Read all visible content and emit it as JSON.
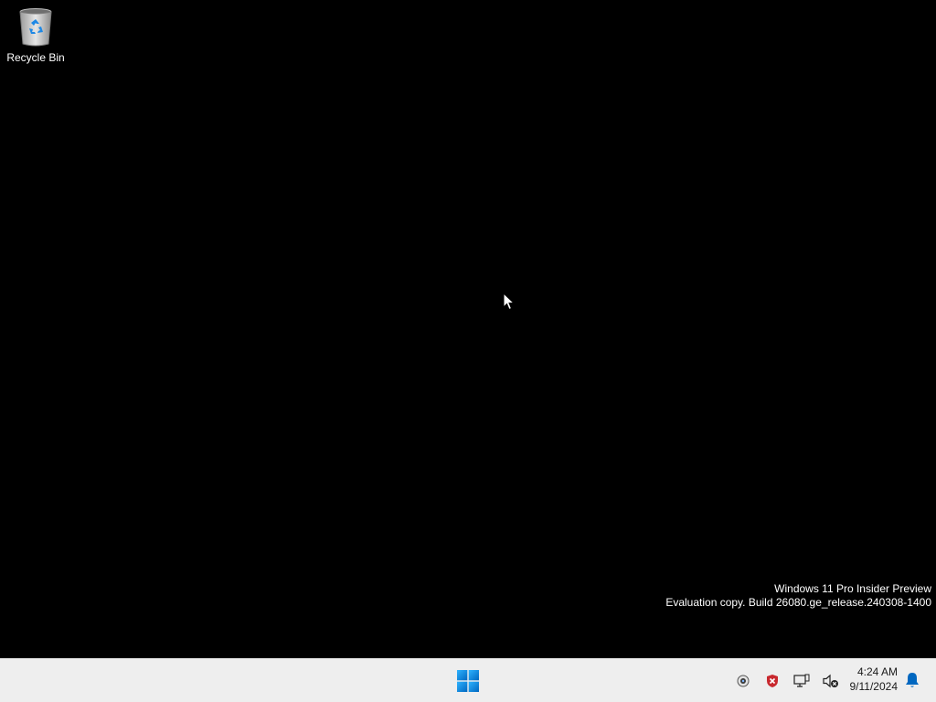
{
  "desktop": {
    "background_color": "#000000",
    "icons": [
      {
        "label": "Recycle Bin",
        "icon": "recycle-bin-icon"
      }
    ]
  },
  "watermark": {
    "line1": "Windows 11 Pro Insider Preview",
    "line2": "Evaluation copy. Build 26080.ge_release.240308-1400"
  },
  "taskbar": {
    "background_color": "#eeeeee",
    "start_icon": "windows-logo-icon",
    "tray_icons": [
      "webcam-icon",
      "security-shield-icon",
      "network-display-icon",
      "speaker-muted-icon"
    ],
    "clock": {
      "time": "4:24 AM",
      "date": "9/11/2024"
    },
    "notification_icon": "notification-bell-icon",
    "accent_color": "#0078d4"
  }
}
